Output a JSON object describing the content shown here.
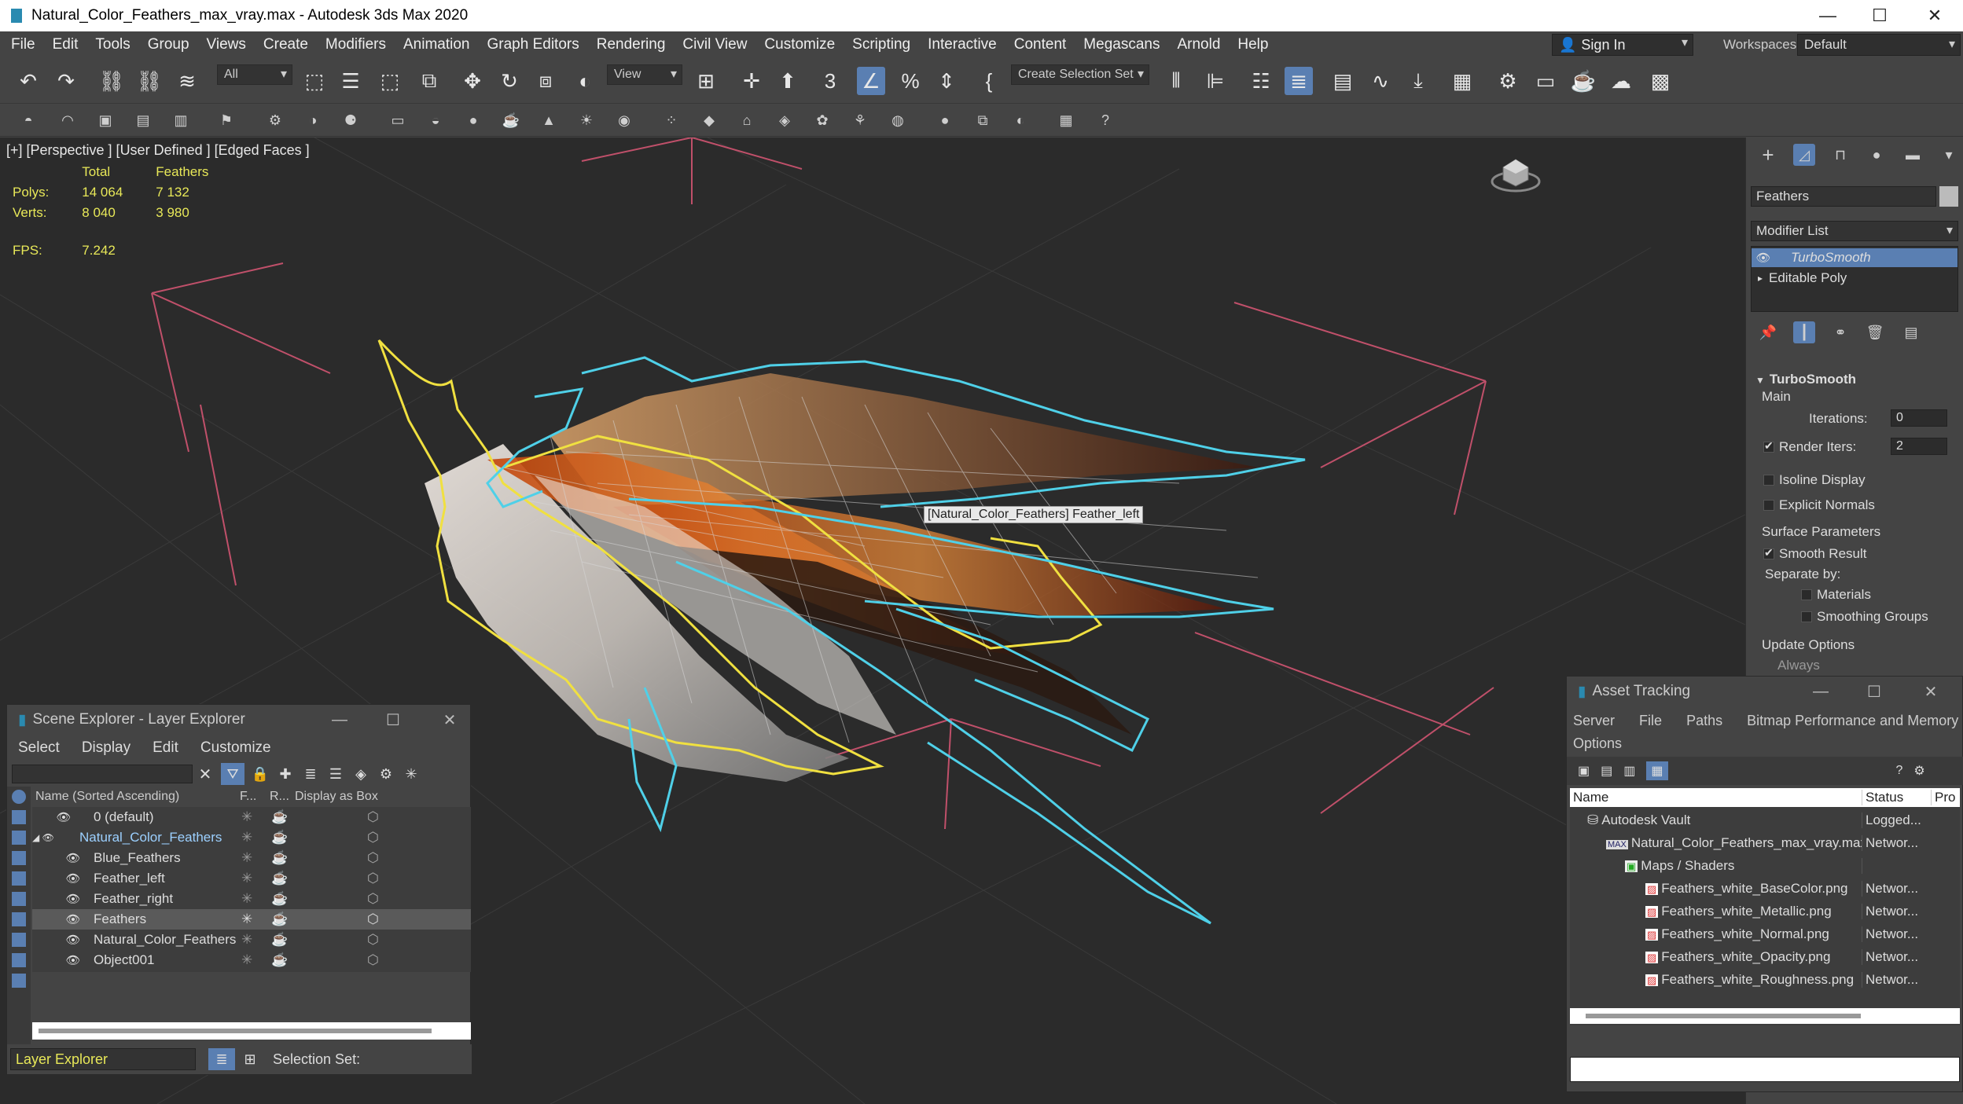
{
  "window": {
    "title": "Natural_Color_Feathers_max_vray.max - Autodesk 3ds Max 2020",
    "minimize": "—",
    "maximize": "☐",
    "close": "✕"
  },
  "menu": [
    "File",
    "Edit",
    "Tools",
    "Group",
    "Views",
    "Create",
    "Modifiers",
    "Animation",
    "Graph Editors",
    "Rendering",
    "Civil View",
    "Customize",
    "Scripting",
    "Interactive",
    "Content",
    "Megascans",
    "Arnold",
    "Help"
  ],
  "signin": "Sign In",
  "workspaces": {
    "label": "Workspaces:",
    "value": "Default"
  },
  "toolbar": {
    "filter": "All",
    "refcoord": "View",
    "selection_set": "Create Selection Set"
  },
  "viewport": {
    "label": "[+] [Perspective ] [User Defined ] [Edged Faces ]",
    "stats": {
      "col_total": "Total",
      "col_sel": "Feathers",
      "polys_label": "Polys:",
      "polys_total": "14 064",
      "polys_sel": "7 132",
      "verts_label": "Verts:",
      "verts_total": "8 040",
      "verts_sel": "3 980",
      "fps_label": "FPS:",
      "fps": "7.242"
    },
    "tooltip": "[Natural_Color_Feathers] Feather_left"
  },
  "command_panel": {
    "object_name": "Feathers",
    "modifier_list": "Modifier List",
    "stack": [
      "TurboSmooth",
      "Editable Poly"
    ],
    "rollout": "TurboSmooth",
    "main": "Main",
    "iterations_label": "Iterations:",
    "iterations": "0",
    "render_iters_label": "Render Iters:",
    "render_iters": "2",
    "isoline": "Isoline Display",
    "explicit": "Explicit Normals",
    "surface_params": "Surface Parameters",
    "smooth_result": "Smooth Result",
    "separate_by": "Separate by:",
    "materials": "Materials",
    "smoothing_groups": "Smoothing Groups",
    "update_options": "Update Options",
    "always": "Always"
  },
  "scene_explorer": {
    "title": "Scene Explorer - Layer Explorer",
    "menu": [
      "Select",
      "Display",
      "Edit",
      "Customize"
    ],
    "columns": {
      "name": "Name (Sorted Ascending)",
      "f": "F...",
      "r": "R...",
      "box": "Display as Box"
    },
    "rows": [
      {
        "name": "0 (default)",
        "indent": 0
      },
      {
        "name": "Natural_Color_Feathers",
        "indent": 0
      },
      {
        "name": "Blue_Feathers",
        "indent": 1
      },
      {
        "name": "Feather_left",
        "indent": 1
      },
      {
        "name": "Feather_right",
        "indent": 1
      },
      {
        "name": "Feathers",
        "indent": 1
      },
      {
        "name": "Natural_Color_Feathers",
        "indent": 1
      },
      {
        "name": "Object001",
        "indent": 1
      }
    ],
    "footer_dd": "Layer Explorer",
    "selection_set": "Selection Set:"
  },
  "asset_tracking": {
    "title": "Asset Tracking",
    "menu": [
      "Server",
      "File",
      "Paths",
      "Bitmap Performance and Memory",
      "Options"
    ],
    "columns": {
      "name": "Name",
      "status": "Status",
      "pro": "Pro"
    },
    "rows": [
      {
        "name": "Autodesk Vault",
        "status": "Logged..."
      },
      {
        "name": "Natural_Color_Feathers_max_vray.max",
        "status": "Networ..."
      },
      {
        "name": "Maps / Shaders",
        "status": ""
      },
      {
        "name": "Feathers_white_BaseColor.png",
        "status": "Networ..."
      },
      {
        "name": "Feathers_white_Metallic.png",
        "status": "Networ..."
      },
      {
        "name": "Feathers_white_Normal.png",
        "status": "Networ..."
      },
      {
        "name": "Feathers_white_Opacity.png",
        "status": "Networ..."
      },
      {
        "name": "Feathers_white_Roughness.png",
        "status": "Networ..."
      }
    ]
  },
  "colors": {
    "accent": "#5a7fb2",
    "selection_yellow": "#f0e040",
    "selection_cyan": "#4fd0e8",
    "grid_pink": "#c0506a",
    "stats_yellow": "#e8e858"
  }
}
